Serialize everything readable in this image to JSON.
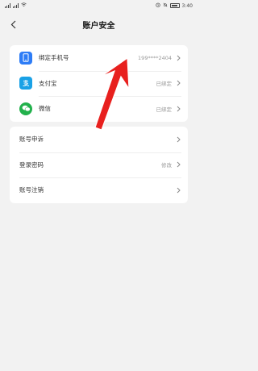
{
  "status_bar": {
    "time": "3:40",
    "battery": "89"
  },
  "header": {
    "title": "账户安全"
  },
  "bindings": [
    {
      "label": "绑定手机号",
      "value": "199****2404",
      "icon": "phone-icon",
      "color": "#2d7cf6"
    },
    {
      "label": "支付宝",
      "value": "已绑定",
      "icon": "alipay-icon",
      "color": "#1aa1e6"
    },
    {
      "label": "微信",
      "value": "已绑定",
      "icon": "wechat-icon",
      "color": "#22b14c"
    }
  ],
  "account_items": [
    {
      "label": "账号申诉",
      "value": ""
    },
    {
      "label": "登录密码",
      "value": "修改"
    },
    {
      "label": "账号注销",
      "value": ""
    }
  ],
  "colors": {
    "annotation_arrow": "#e8201e",
    "background": "#f2f2f2"
  }
}
